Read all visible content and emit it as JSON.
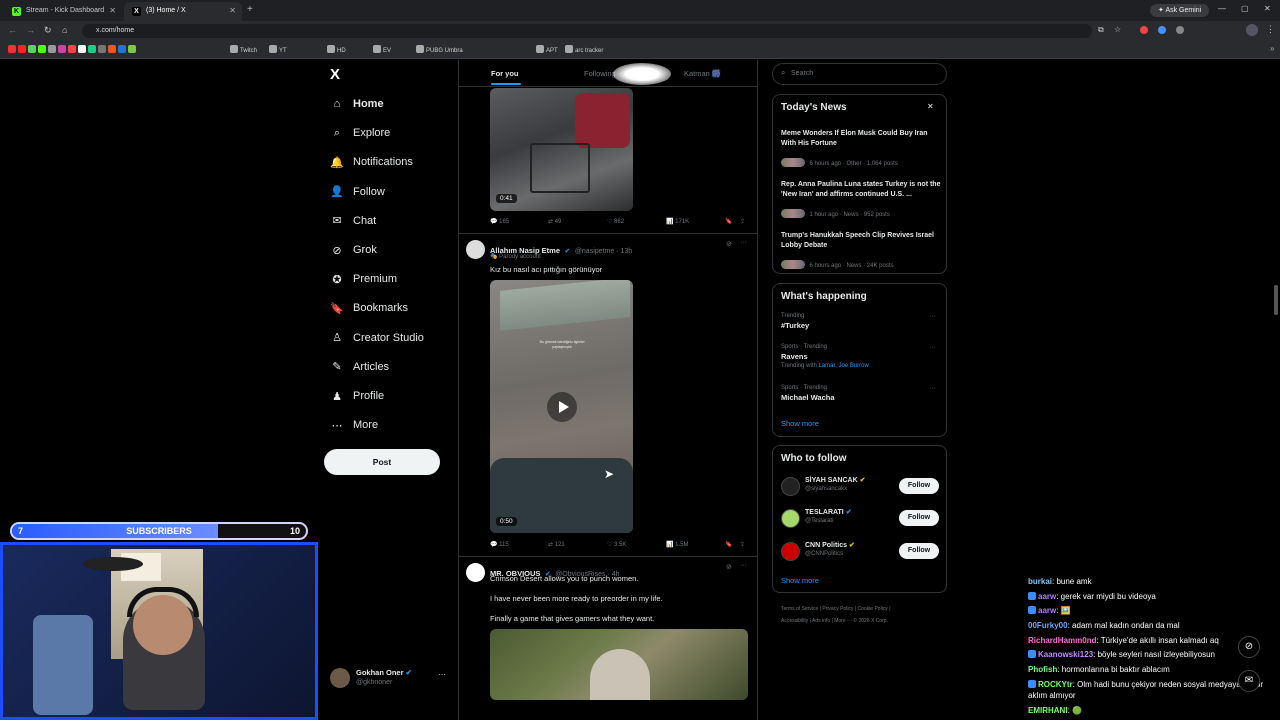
{
  "browser": {
    "tabs": [
      {
        "title": "Stream - Kick Dashboard",
        "icon": "kick-icon"
      },
      {
        "title": "(3) Home / X",
        "icon": "x-icon"
      }
    ],
    "ask_gemini": "Ask Gemini",
    "url": "x.com/home",
    "bookmarks": [
      "Twitch",
      "YT",
      "HD",
      "EV",
      "PUBG Umbra",
      "APT",
      "arc tracker"
    ]
  },
  "nav": {
    "logo": "X",
    "items": [
      {
        "label": "Home",
        "icon": "home-icon"
      },
      {
        "label": "Explore",
        "icon": "search-icon"
      },
      {
        "label": "Notifications",
        "icon": "bell-icon"
      },
      {
        "label": "Follow",
        "icon": "person-add-icon"
      },
      {
        "label": "Chat",
        "icon": "mail-icon"
      },
      {
        "label": "Grok",
        "icon": "grok-icon"
      },
      {
        "label": "Premium",
        "icon": "premium-icon"
      },
      {
        "label": "Bookmarks",
        "icon": "bookmark-icon"
      },
      {
        "label": "Creator Studio",
        "icon": "creator-icon"
      },
      {
        "label": "Articles",
        "icon": "articles-icon"
      },
      {
        "label": "Profile",
        "icon": "profile-icon"
      },
      {
        "label": "More",
        "icon": "more-circle-icon"
      }
    ],
    "post_button": "Post",
    "account": {
      "name": "Gokhan Oner",
      "handle": "@gkhnoner"
    }
  },
  "feed": {
    "tabs": [
      "For you",
      "Following",
      "Katman 🎆"
    ],
    "tweets": [
      {
        "video_duration": "0:41",
        "stats": {
          "replies": "165",
          "reposts": "49",
          "likes": "862",
          "views": "171K"
        }
      },
      {
        "name": "Allahım Nasip Etme",
        "handle": "@nasipetme · 13h",
        "sub": "Parody account",
        "text": "Kız bu nasıl acı pıttığın görünüyor",
        "video_caption": "Bu görmek istediğiniz ilgimizi paylaşmıştık",
        "video_duration": "0:50",
        "stats": {
          "replies": "115",
          "reposts": "121",
          "likes": "3.5K",
          "views": "1.5M"
        }
      },
      {
        "name": "MR. OBVIOUS",
        "handle": "@ObviousRises · 4h",
        "lines": [
          "Crimson Desert allows you to punch women.",
          "I have never been more ready to preorder in my life.",
          "Finally a game that gives gamers what they want."
        ]
      }
    ]
  },
  "sidebar": {
    "search_placeholder": "Search",
    "news": {
      "title": "Today's News",
      "items": [
        {
          "headline": "Meme Wonders If Elon Musk Could Buy Iran With His Fortune",
          "meta": "6 hours ago · Other · 1,064 posts"
        },
        {
          "headline": "Rep. Anna Paulina Luna states Turkey is not the 'New Iran' and affirms continued U.S. ...",
          "meta": "1 hour ago · News · 952 posts"
        },
        {
          "headline": "Trump's Hanukkah Speech Clip Revives Israel Lobby Debate",
          "meta": "6 hours ago · News · 24K posts"
        }
      ]
    },
    "happening": {
      "title": "What's happening",
      "items": [
        {
          "context": "Trending",
          "topic": "#Turkey",
          "extra": ""
        },
        {
          "context": "Sports · Trending",
          "topic": "Ravens",
          "extra_prefix": "Trending with ",
          "extra": "Lamar, Joe Burrow"
        },
        {
          "context": "Sports · Trending",
          "topic": "Michael Wacha",
          "extra": ""
        }
      ],
      "show_more": "Show more"
    },
    "who_to_follow": {
      "title": "Who to follow",
      "items": [
        {
          "name": "SİYAH SANCAK",
          "handle": "@siyahsancakx",
          "button": "Follow"
        },
        {
          "name": "TESLARATI",
          "handle": "@Teslarati",
          "button": "Follow"
        },
        {
          "name": "CNN Politics",
          "handle": "@CNNPolitics",
          "button": "Follow"
        }
      ],
      "show_more": "Show more"
    },
    "footer": [
      "Terms of Service",
      "Privacy Policy",
      "Cookie Policy",
      "Accessibility",
      "Ads info",
      "More ···",
      "© 2026 X Corp."
    ]
  },
  "overlay": {
    "sub_goal": {
      "current": "7",
      "label": "SUBSCRIBERS",
      "target": "10",
      "progress": 0.7
    },
    "chat": [
      {
        "user": "burkai",
        "color": "#7ec8ff",
        "msg": ": bune amk"
      },
      {
        "user": "aarw",
        "color": "#b57bff",
        "msg": ": gerek var miydi bu videoya"
      },
      {
        "user": "aarw",
        "color": "#b57bff",
        "msg": ": 🖼️"
      },
      {
        "user": "00Furky00",
        "color": "#6aa8ff",
        "msg": ": adam mal kadın ondan da mal"
      },
      {
        "user": "RichardHamm0nd",
        "color": "#ff6ad5",
        "msg": ": Türkiye'de akıllı insan kalmadı aq"
      },
      {
        "user": "Kaanowski123",
        "color": "#c58bff",
        "msg": ": böyle seyleri nasıl izleyebiliyosun"
      },
      {
        "user": "Phofish",
        "color": "#6dff8a",
        "msg": ": hormonlarına bi baktır ablacım"
      },
      {
        "user": "ROCKYtr",
        "color": "#7dff6a",
        "msg": ": Olm hadi bunu çekiyor neden sosyal medyaya atıyor aklım almıyor"
      },
      {
        "user": "EMIRHANI",
        "color": "#7dff6a",
        "msg": ": 🟢"
      }
    ]
  }
}
